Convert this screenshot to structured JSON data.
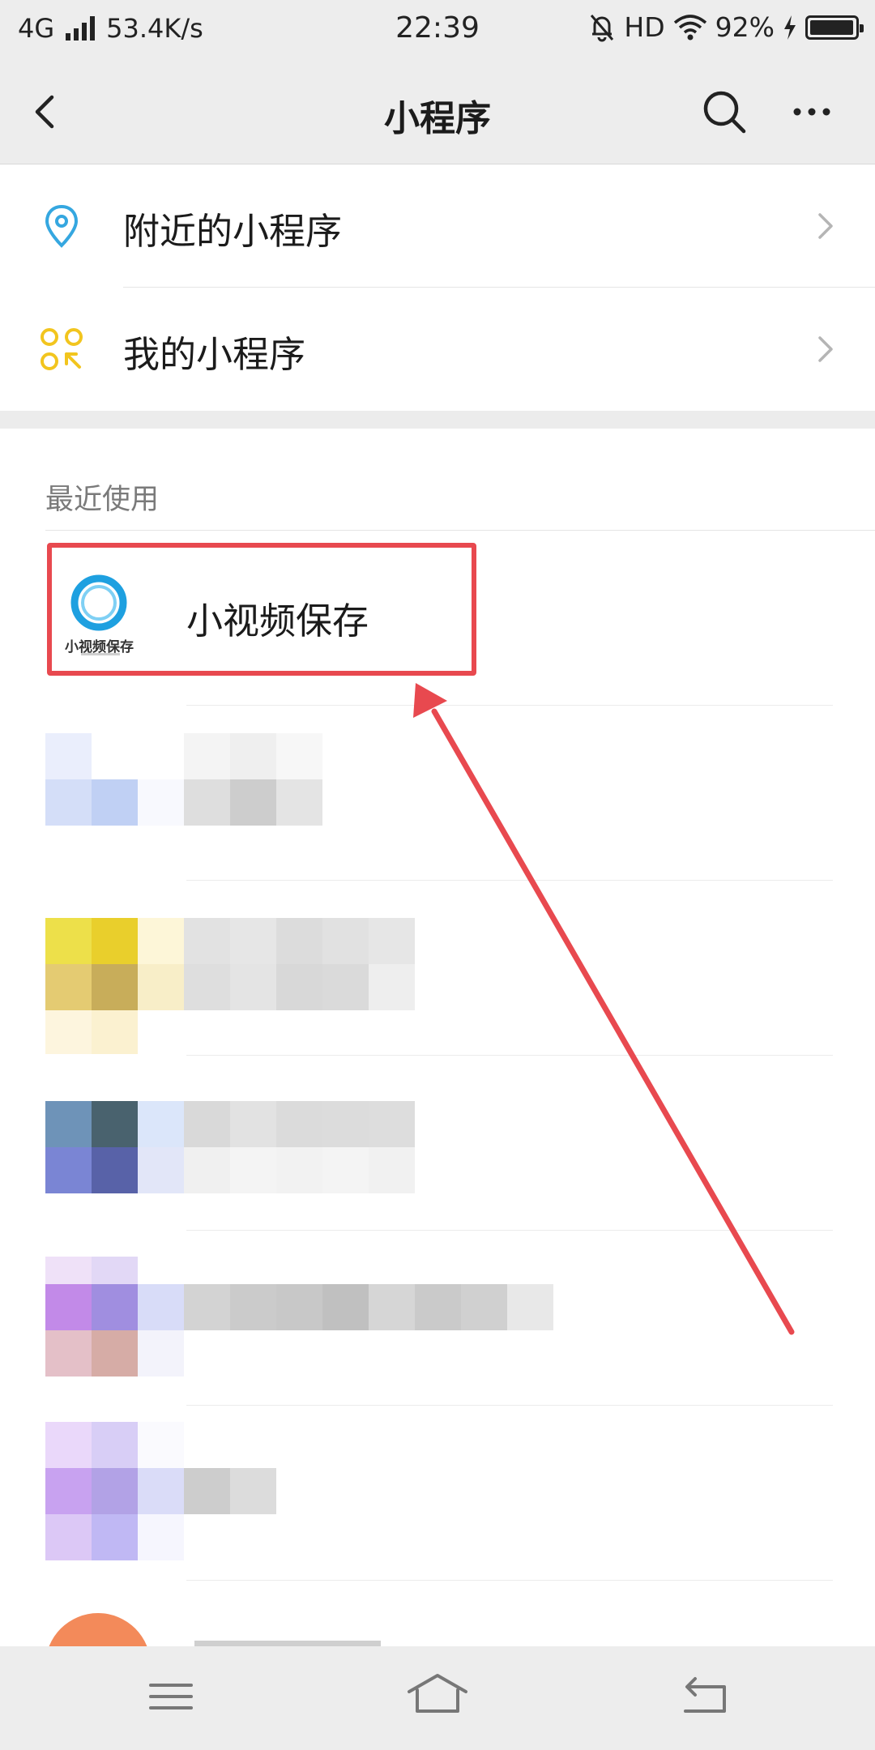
{
  "status_bar": {
    "network": "4G",
    "speed": "53.4K/s",
    "time": "22:39",
    "hd": "HD",
    "battery": "92%"
  },
  "nav": {
    "title": "小程序",
    "icons": [
      "back-chevron-icon",
      "search-icon",
      "more-dots-icon"
    ]
  },
  "menu": {
    "items": [
      {
        "label": "附近的小程序",
        "icon": "location-pin-icon"
      },
      {
        "label": "我的小程序",
        "icon": "grid-circles-icon"
      }
    ]
  },
  "recent": {
    "header": "最近使用",
    "first_app": {
      "name": "小视频保存",
      "logo_text": "小视频保存"
    }
  },
  "colors": {
    "accent_red": "#e8494f",
    "location_blue": "#35a7e0",
    "mine_yellow": "#f2c51e"
  },
  "bottom_nav": {
    "icons": [
      "menu-lines-icon",
      "home-icon",
      "back-arrow-icon"
    ]
  }
}
